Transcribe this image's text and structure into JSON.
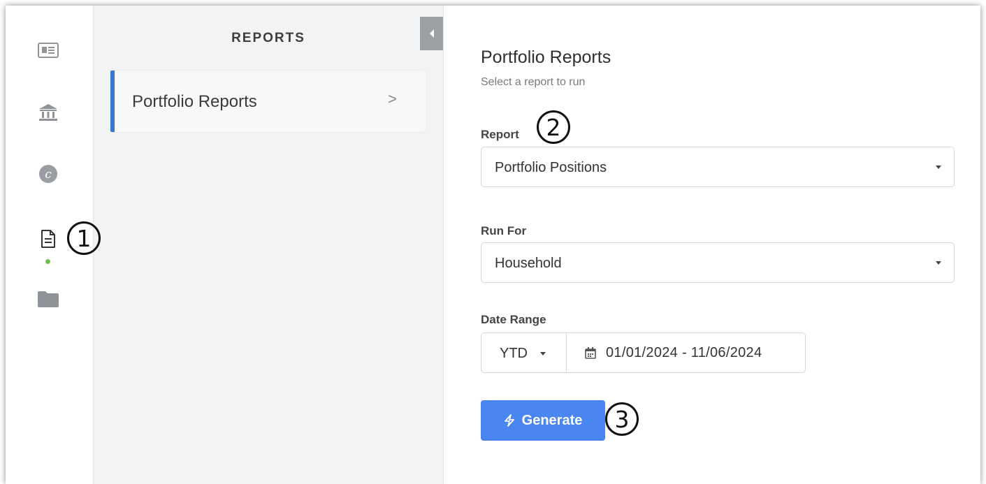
{
  "rail": {
    "icons": [
      "newspaper-icon",
      "bank-icon",
      "contact-icon",
      "document-icon",
      "folder-icon"
    ],
    "active_index": 3
  },
  "panel": {
    "title": "REPORTS",
    "items": [
      {
        "label": "Portfolio Reports",
        "chevron": ">"
      }
    ]
  },
  "main": {
    "title": "Portfolio Reports",
    "subtitle": "Select a report to run",
    "report": {
      "label": "Report",
      "value": "Portfolio Positions"
    },
    "run_for": {
      "label": "Run For",
      "value": "Household"
    },
    "date_range": {
      "label": "Date Range",
      "preset": "YTD",
      "range": "01/01/2024 - 11/06/2024"
    },
    "generate_label": "Generate"
  },
  "callouts": {
    "one": "1",
    "two": "2",
    "three": "3"
  },
  "colors": {
    "accent": "#3a78d0",
    "button": "#4a86f0",
    "active_dot": "#6cc24a"
  }
}
